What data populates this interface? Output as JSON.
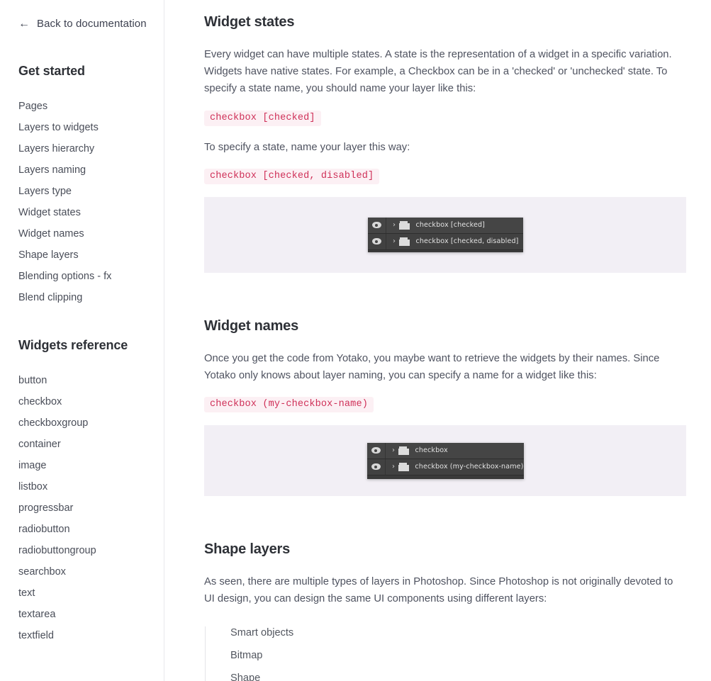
{
  "sidebar": {
    "back_link": {
      "label": "Back to documentation",
      "icon": "arrow-left-icon"
    },
    "groups": [
      {
        "title": "Get started",
        "items": [
          "Pages",
          "Layers to widgets",
          "Layers hierarchy",
          "Layers naming",
          "Layers type",
          "Widget states",
          "Widget names",
          "Shape layers",
          "Blending options - fx",
          "Blend clipping"
        ]
      },
      {
        "title": "Widgets reference",
        "items": [
          "button",
          "checkbox",
          "checkboxgroup",
          "container",
          "image",
          "listbox",
          "progressbar",
          "radiobutton",
          "radiobuttongroup",
          "searchbox",
          "text",
          "textarea",
          "textfield"
        ]
      }
    ]
  },
  "content": {
    "widget_states": {
      "heading": "Widget states",
      "paragraph": "Every widget can have multiple states. A state is the representation of a widget in a specific variation. Widgets have native states. For example, a Checkbox can be in a 'checked' or 'unchecked' state. To specify a state name, you should name your layer like this:",
      "code_1": "checkbox [checked]",
      "paragraph_2": "To specify a state, name your layer this way:",
      "code_2": "checkbox [checked, disabled]",
      "figure": {
        "rows": [
          {
            "label": "checkbox [checked]",
            "eye": "eye-icon",
            "chevron": "›",
            "folder": "folder-icon"
          },
          {
            "label": "checkbox [checked, disabled]",
            "eye": "eye-icon",
            "chevron": "›",
            "folder": "folder-icon"
          }
        ]
      }
    },
    "widget_names": {
      "heading": "Widget names",
      "paragraph": "Once you get the code from Yotako, you maybe want to retrieve the widgets by their names. Since Yotako only knows about layer naming, you can specify a name for a widget like this:",
      "code_1": "checkbox (my-checkbox-name)",
      "figure": {
        "rows": [
          {
            "label": "checkbox",
            "eye": "eye-icon",
            "chevron": "›",
            "folder": "folder-icon"
          },
          {
            "label": "checkbox (my-checkbox-name)",
            "eye": "eye-icon",
            "chevron": "›",
            "folder": "folder-icon"
          }
        ]
      }
    },
    "shape_layers": {
      "heading": "Shape layers",
      "paragraph": "As seen, there are multiple types of layers in Photoshop. Since Photoshop is not originally devoted to UI design, you can design the same UI components using different layers:",
      "list": [
        "Smart objects",
        "Bitmap",
        "Shape"
      ]
    }
  },
  "colors": {
    "accent": "#cf3058",
    "code_bg": "#fcf0f4",
    "figure_bg": "#f2eff5",
    "panel_bg": "#454545",
    "heading": "#2e3137",
    "body": "#4f5360"
  }
}
